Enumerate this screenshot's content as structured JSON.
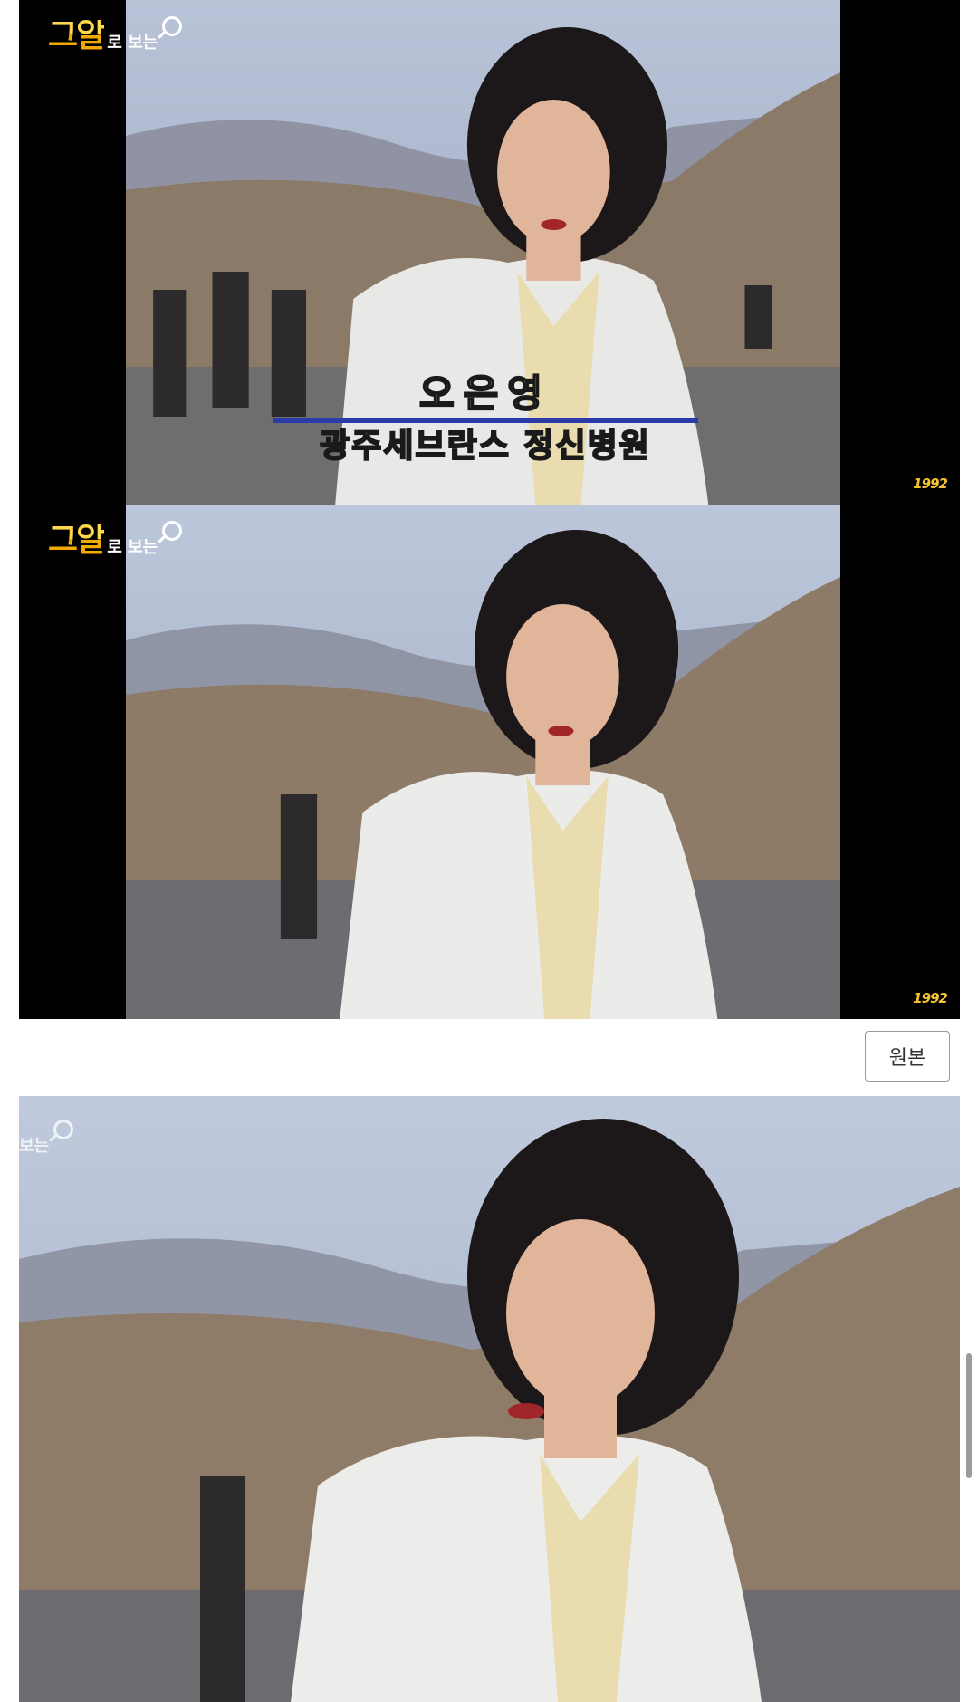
{
  "frames": [
    {
      "logo_main": "그알",
      "logo_sub": "로 보는",
      "watermark": "1992",
      "caption_name": "오은영",
      "caption_org": "광주세브란스 정신병원"
    },
    {
      "logo_main": "그알",
      "logo_sub": "로 보는",
      "watermark": "1992"
    },
    {
      "logo_sub": "보는"
    }
  ],
  "original_button": {
    "label": "원본"
  }
}
